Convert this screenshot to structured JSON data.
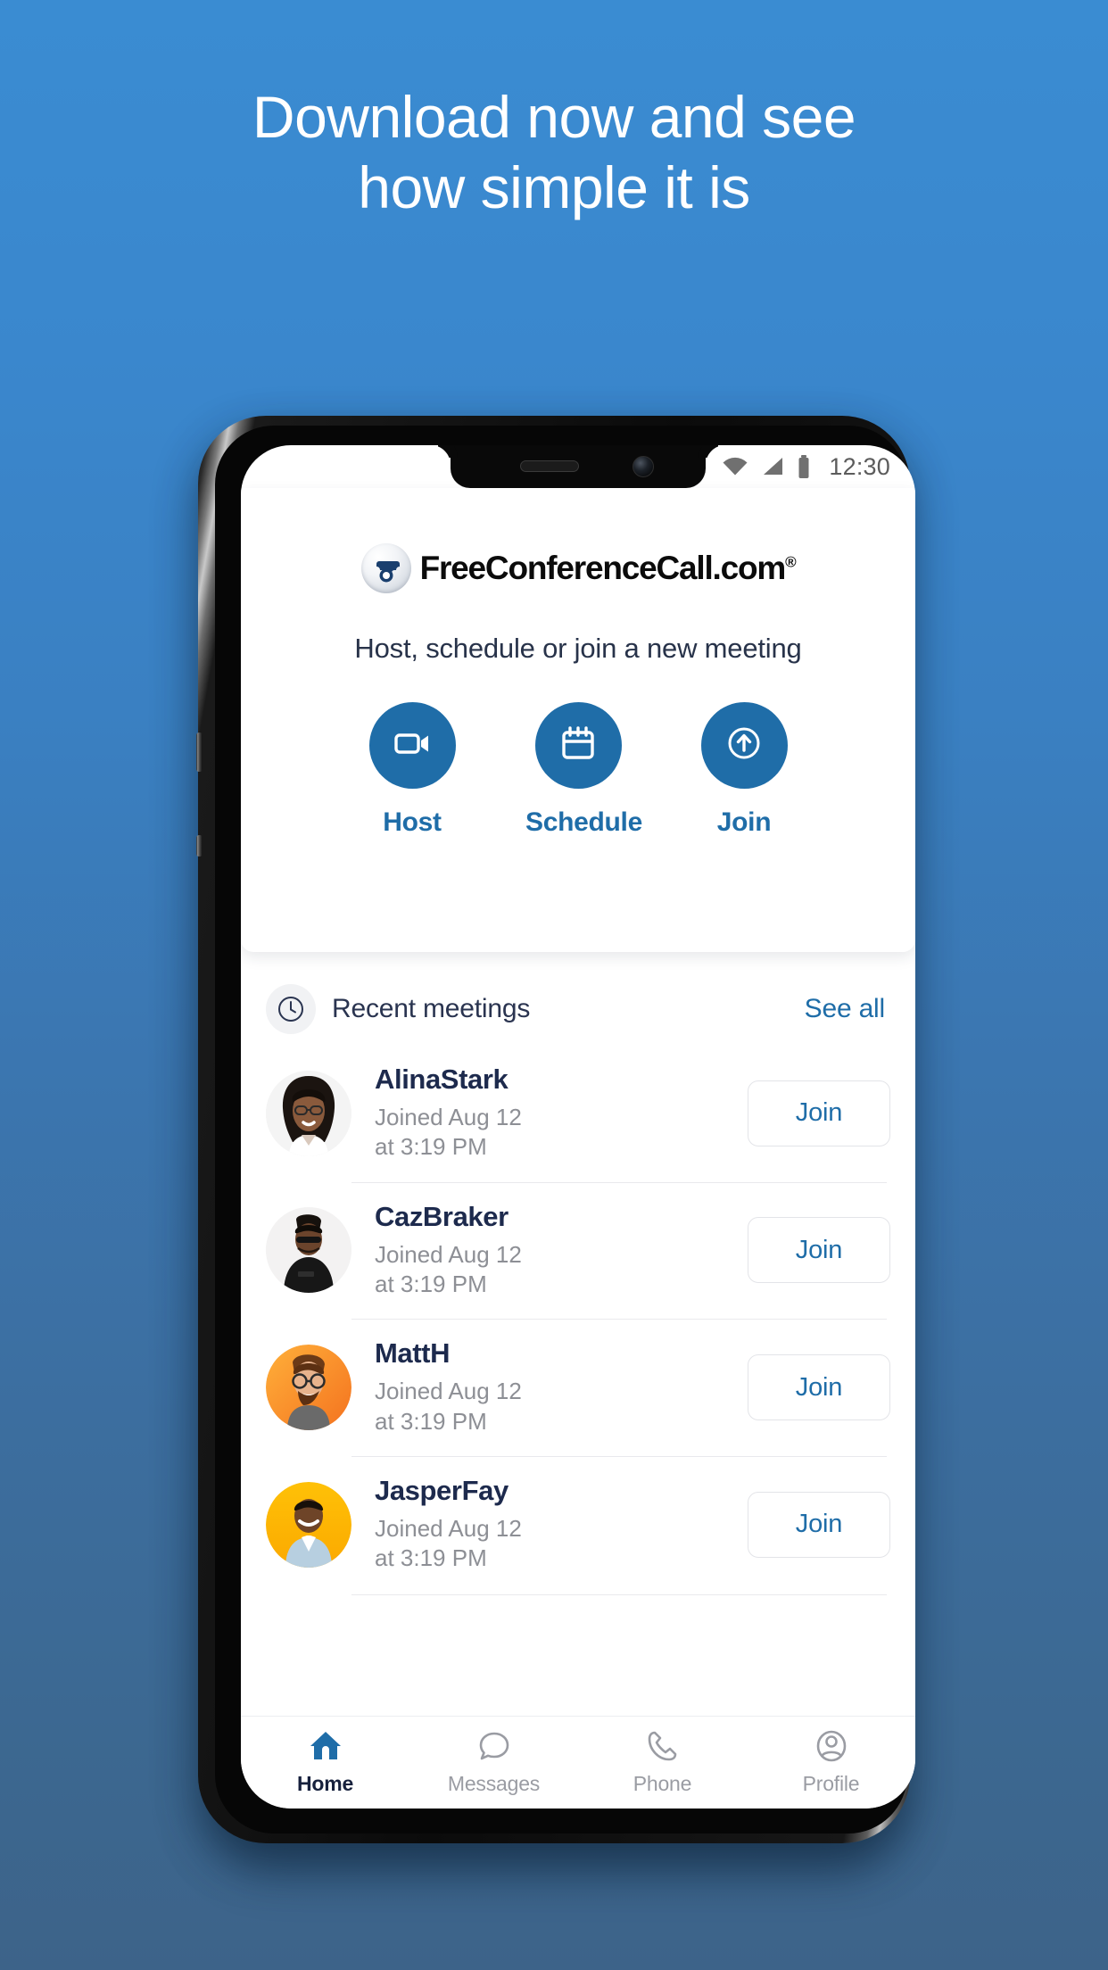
{
  "hero": {
    "headline_line1": "Download now and see",
    "headline_line2": "how simple it is"
  },
  "colors": {
    "background_top": "#3a8cd2",
    "background_bottom": "#3d6389",
    "accent_blue": "#1f6da8",
    "heading_navy": "#1d2a4d",
    "muted_gray": "#8d8f95"
  },
  "phone": {
    "statusbar": {
      "wifi_icon": "wifi-icon",
      "signal_icon": "signal-icon",
      "battery_icon": "battery-icon",
      "time": "12:30"
    },
    "app": {
      "logo": {
        "icon": "telephone-badge-icon",
        "text": "FreeConferenceCall.com",
        "registered_mark": "®"
      },
      "subtitle": "Host, schedule or join a new meeting",
      "actions": [
        {
          "icon": "video-camera-icon",
          "label": "Host"
        },
        {
          "icon": "calendar-icon",
          "label": "Schedule"
        },
        {
          "icon": "arrow-up-circle-icon",
          "label": "Join"
        }
      ],
      "recent": {
        "icon": "clock-icon",
        "title": "Recent meetings",
        "see_all_label": "See all",
        "join_label": "Join",
        "items": [
          {
            "name": "AlinaStark",
            "joined": "Joined Aug 12",
            "time": "at 3:19 PM",
            "join_label": "Join"
          },
          {
            "name": "CazBraker",
            "joined": "Joined Aug 12",
            "time": "at 3:19 PM",
            "join_label": "Join"
          },
          {
            "name": "MattH",
            "joined": "Joined Aug 12",
            "time": "at 3:19 PM",
            "join_label": "Join"
          },
          {
            "name": "JasperFay",
            "joined": "Joined Aug 12",
            "time": "at 3:19 PM",
            "join_label": "Join"
          }
        ]
      },
      "bottom_nav": [
        {
          "icon": "home-icon",
          "label": "Home",
          "active": true
        },
        {
          "icon": "message-bubble-icon",
          "label": "Messages",
          "active": false
        },
        {
          "icon": "phone-handset-icon",
          "label": "Phone",
          "active": false
        },
        {
          "icon": "profile-person-icon",
          "label": "Profile",
          "active": false
        }
      ]
    }
  }
}
